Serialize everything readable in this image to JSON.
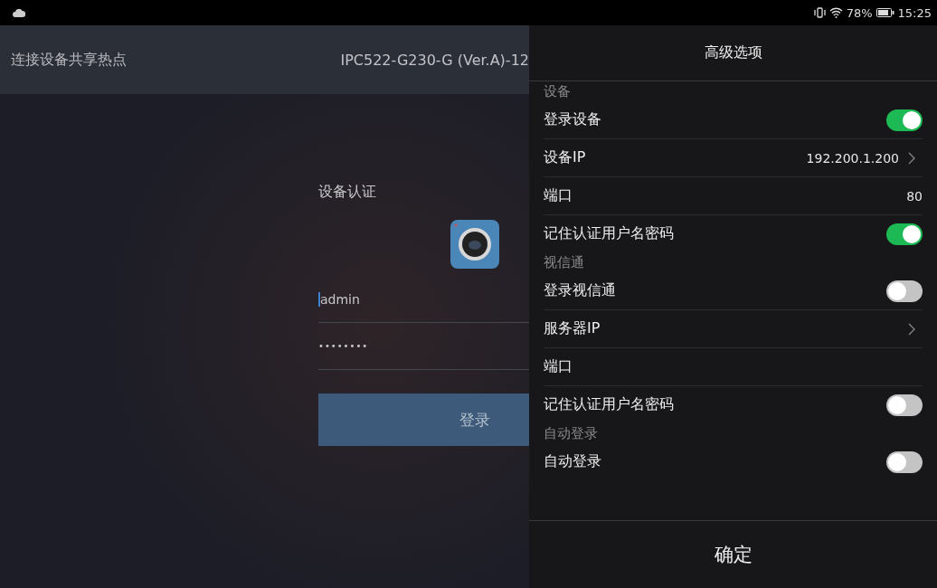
{
  "status_bar": {
    "battery": "78%",
    "time": "15:25"
  },
  "header": {
    "label": "连接设备共享热点",
    "title": "IPC522-G230-G (Ver.A)-12"
  },
  "login": {
    "title": "设备认证",
    "username": "admin",
    "password": "••••••••",
    "button": "登录"
  },
  "panel": {
    "title": "高级选项",
    "items": [
      {
        "kind": "section",
        "label": "设备"
      },
      {
        "kind": "switch",
        "label": "登录设备",
        "on": true
      },
      {
        "kind": "link",
        "label": "设备IP",
        "value": "192.200.1.200"
      },
      {
        "kind": "text",
        "label": "端口",
        "value": "80"
      },
      {
        "kind": "switch",
        "label": "记住认证用户名密码",
        "on": true
      },
      {
        "kind": "section",
        "label": "视信通"
      },
      {
        "kind": "switch",
        "label": "登录视信通",
        "on": false
      },
      {
        "kind": "link",
        "label": "服务器IP"
      },
      {
        "kind": "text",
        "label": "端口"
      },
      {
        "kind": "switch",
        "label": "记住认证用户名密码",
        "on": false
      },
      {
        "kind": "section",
        "label": "自动登录"
      },
      {
        "kind": "switch",
        "label": "自动登录",
        "on": false
      }
    ],
    "confirm": "确定"
  }
}
